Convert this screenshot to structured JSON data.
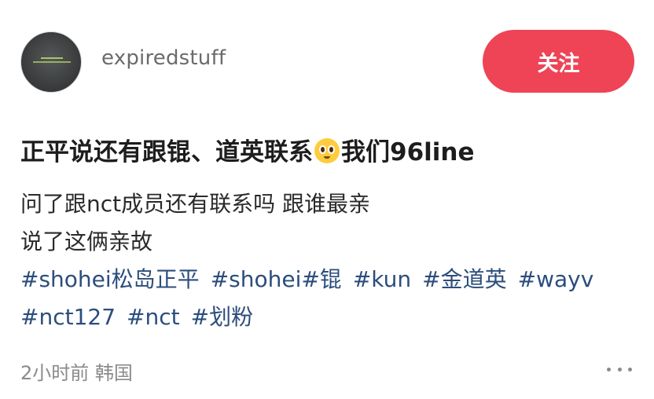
{
  "author": {
    "username": "expiredstuff",
    "avatar_icon": "avatar-image"
  },
  "actions": {
    "follow_label": "关注",
    "follow_color": "#ee4456"
  },
  "post": {
    "title_before_emoji": "正平说还有跟锟、道英联系",
    "title_emoji_icon": "pleading-face-emoji",
    "title_after_emoji": "我们96line",
    "body_lines": [
      "问了跟nct成员还有联系吗 跟谁最亲",
      "说了这俩亲故"
    ],
    "tags_row1": [
      "#shohei松岛正平",
      "#shohei#锟",
      "#kun",
      "#金道英",
      "#wayv"
    ],
    "tags_row2": [
      "#nct127",
      "#nct",
      "#划粉"
    ],
    "tag_color": "#2c4d7d"
  },
  "footer": {
    "meta": "2小时前 韩国",
    "more_icon": "more-dots-icon"
  }
}
